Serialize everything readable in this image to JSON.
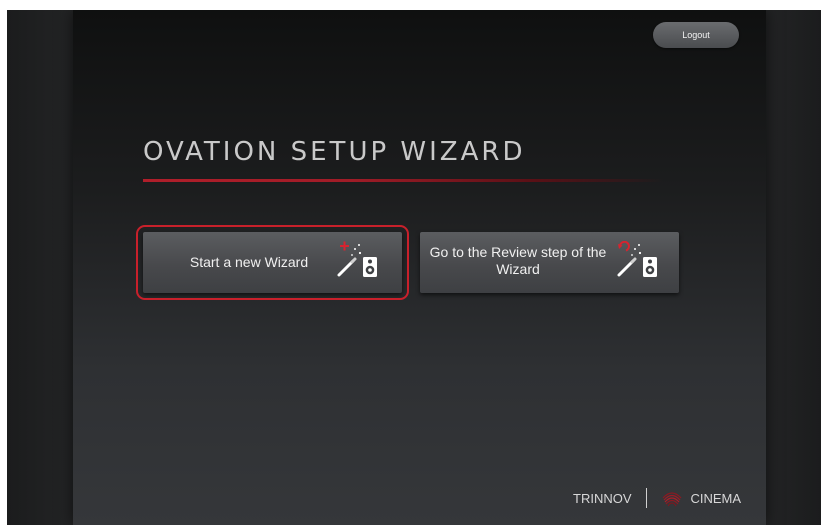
{
  "header": {
    "logout_label": "Logout"
  },
  "main": {
    "title": "OVATION SETUP WIZARD",
    "buttons": [
      {
        "label": "Start a new Wizard",
        "icon": "magic-wand-speaker-plus-icon",
        "selected": true
      },
      {
        "label": "Go to the Review step of the Wizard",
        "icon": "magic-wand-speaker-review-icon",
        "selected": false
      }
    ]
  },
  "footer": {
    "brand": "TRINNOV",
    "product": "CINEMA"
  },
  "colors": {
    "accent_red": "#c8202b",
    "panel_dark": "#0f1010",
    "text_light": "#f0f0f0"
  }
}
